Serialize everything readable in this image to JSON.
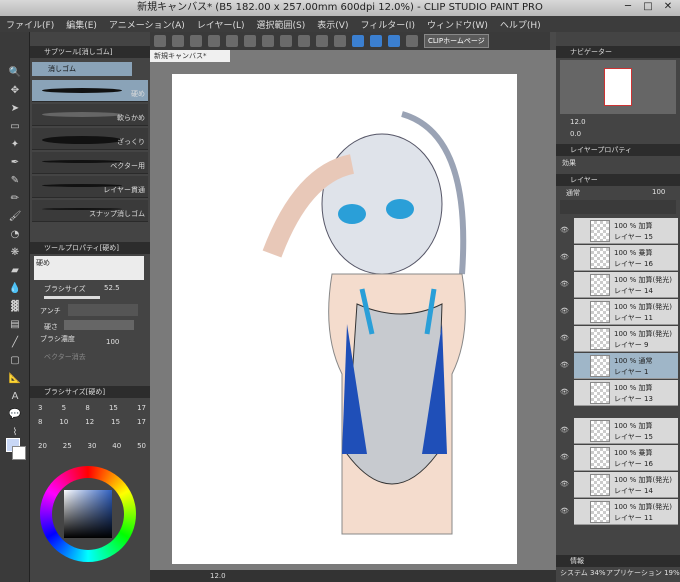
{
  "window": {
    "title": "新規キャンバス* (B5 182.00 x 257.00mm 600dpi 12.0%) - CLIP STUDIO PAINT PRO"
  },
  "menu": [
    "ファイル(F)",
    "編集(E)",
    "アニメーション(A)",
    "レイヤー(L)",
    "選択範囲(S)",
    "表示(V)",
    "フィルター(I)",
    "ウィンドウ(W)",
    "ヘルプ(H)"
  ],
  "toolbar": {
    "clip_home": "CLIPホームページ"
  },
  "subtool": {
    "header": "サブツール[消しゴム]",
    "tab": "消しゴム",
    "brushes": [
      "硬め",
      "軟らかめ",
      "ざっくり",
      "ベクター用",
      "レイヤー貫通",
      "スナップ消しゴム"
    ]
  },
  "toolprop": {
    "header": "ツールプロパティ[硬め]",
    "name": "硬め",
    "brush_size_label": "ブラシサイズ",
    "brush_size": "52.5",
    "antialias_label": "アンチ",
    "hardness_label": "硬さ",
    "density_label": "ブラシ濃度",
    "density": "100",
    "vector_label": "ベクター消去"
  },
  "brushsize": {
    "header": "ブラシサイズ[硬め]",
    "sizes_row1": [
      "3",
      "5",
      "8",
      "15",
      "17"
    ],
    "sizes_row2": [
      "8",
      "10",
      "12",
      "15",
      "17"
    ],
    "sizes_row3": [
      "20",
      "25",
      "30",
      "40",
      "50"
    ]
  },
  "color": {
    "r": "200",
    "g": "215",
    "b": "246"
  },
  "canvas": {
    "tab": "新規キャンバス*",
    "zoom": "12.0"
  },
  "navigator": {
    "header": "ナビゲーター",
    "zoom": "12.0",
    "angle": "0.0"
  },
  "layerprop": {
    "header": "レイヤープロパティ",
    "effect": "効果"
  },
  "layers": {
    "tab": "レイヤー",
    "blend": "通常",
    "opacity": "100",
    "items": [
      {
        "mode": "100 % 加算",
        "name": "レイヤー 15"
      },
      {
        "mode": "100 % 乗算",
        "name": "レイヤー 16"
      },
      {
        "mode": "100 % 加算(発光)",
        "name": "レイヤー 14"
      },
      {
        "mode": "100 % 加算(発光)",
        "name": "レイヤー 11"
      },
      {
        "mode": "100 % 加算(発光)",
        "name": "レイヤー 9"
      },
      {
        "mode": "100 % 通常",
        "name": "レイヤー 1"
      },
      {
        "mode": "100 % 加算",
        "name": "レイヤー 13"
      },
      {
        "mode": "100 % 加算",
        "name": "レイヤー 15"
      },
      {
        "mode": "100 % 乗算",
        "name": "レイヤー 16"
      },
      {
        "mode": "100 % 加算(発光)",
        "name": "レイヤー 14"
      },
      {
        "mode": "100 % 加算(発光)",
        "name": "レイヤー 11"
      }
    ]
  },
  "info": {
    "label": "情報",
    "system": "システム 34%",
    "app": "アプリケーション 19%"
  }
}
